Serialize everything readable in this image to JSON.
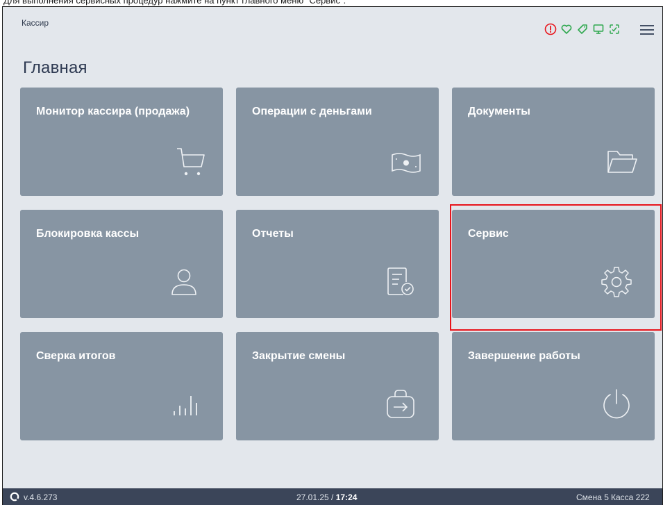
{
  "caption": "Для выполнения сервисных процедур нажмите на пункт главного меню \"Сервис\".",
  "header": {
    "role": "Кассир",
    "status_icons": [
      "alert-icon",
      "heart-icon",
      "tag-icon",
      "monitor-icon",
      "scan-icon"
    ],
    "menu_icon": "hamburger-menu-icon"
  },
  "page_title": "Главная",
  "tiles": [
    {
      "label": "Монитор кассира (продажа)",
      "icon": "cart-icon"
    },
    {
      "label": "Операции с деньгами",
      "icon": "money-icon"
    },
    {
      "label": "Документы",
      "icon": "folder-icon"
    },
    {
      "label": "Блокировка кассы",
      "icon": "user-icon"
    },
    {
      "label": "Отчеты",
      "icon": "report-icon"
    },
    {
      "label": "Сервис",
      "icon": "gear-icon"
    },
    {
      "label": "Сверка итогов",
      "icon": "bar-chart-icon"
    },
    {
      "label": "Закрытие смены",
      "icon": "exit-icon"
    },
    {
      "label": "Завершение работы",
      "icon": "power-icon"
    }
  ],
  "highlighted_tile": "Сервис",
  "footer": {
    "version": "v.4.6.273",
    "date": "27.01.25",
    "separator": " / ",
    "time": "17:24",
    "shift": "Смена 5",
    "till": "Касса 222"
  },
  "colors": {
    "background": "#e3e7ec",
    "tile": "#8795a3",
    "bottombar": "#3b4559",
    "highlight": "#e8141b",
    "status_alert": "#e8141b",
    "status_ok": "#2fa84f"
  }
}
